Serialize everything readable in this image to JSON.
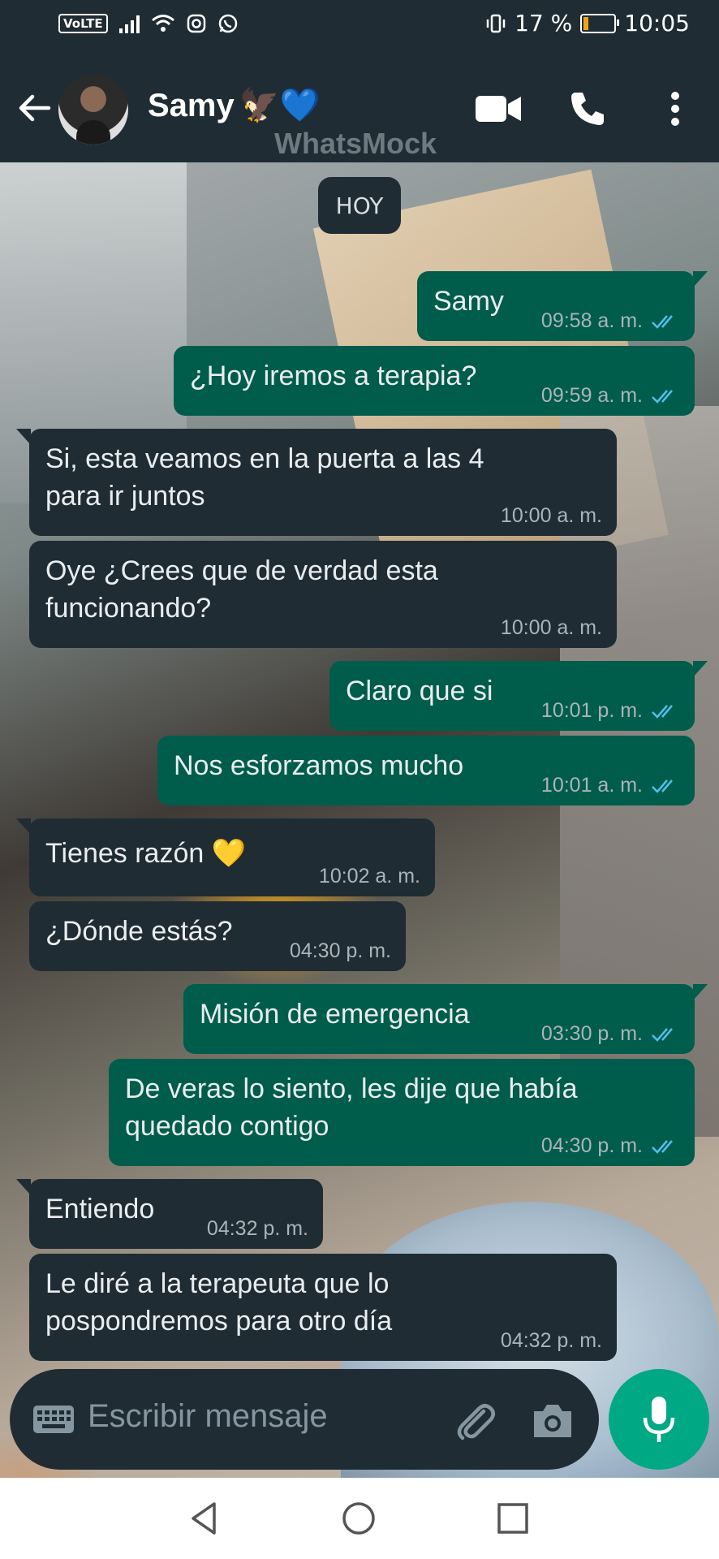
{
  "status_bar": {
    "volte": "VoLTE",
    "battery_text": "17 %",
    "battery_level": 0.17,
    "time": "10:05",
    "icons": [
      "signal-icon",
      "wifi-icon",
      "instagram-icon",
      "whatsapp-icon",
      "vibrate-icon",
      "battery-icon"
    ]
  },
  "header": {
    "contact_name": "Samy",
    "contact_emoji": "🦅💙",
    "watermark": "WhatsMock",
    "icons": [
      "back-arrow-icon",
      "video-call-icon",
      "phone-icon",
      "more-options-icon"
    ]
  },
  "chat": {
    "date_chip": "HOY",
    "messages": [
      {
        "dir": "out",
        "text": "Samy",
        "time": "09:58 a. m.",
        "ticks": "read"
      },
      {
        "dir": "out",
        "text": "¿Hoy iremos a terapia?",
        "time": "09:59 a. m.",
        "ticks": "read"
      },
      {
        "dir": "in",
        "text": "Si, esta veamos en la puerta a las 4",
        "text2": "para ir juntos",
        "time": "10:00 a. m."
      },
      {
        "dir": "in",
        "text": "Oye ¿Crees que de verdad esta",
        "text2": "funcionando?",
        "time": "10:00 a. m."
      },
      {
        "dir": "out",
        "text": "Claro que si",
        "time": "10:01 p. m.",
        "ticks": "read"
      },
      {
        "dir": "out",
        "text": "Nos esforzamos mucho",
        "time": "10:01 a. m.",
        "ticks": "read"
      },
      {
        "dir": "in",
        "text": "Tienes razón 💛",
        "time": "10:02 a. m."
      },
      {
        "dir": "in",
        "text": "¿Dónde estás?",
        "time": "04:30 p. m."
      },
      {
        "dir": "out",
        "text": "Misión de emergencia",
        "time": "03:30 p. m.",
        "ticks": "read"
      },
      {
        "dir": "out",
        "text": "De veras lo siento, les dije que había",
        "text2": "quedado contigo",
        "time": "04:30 p. m.",
        "ticks": "read"
      },
      {
        "dir": "in",
        "text": "Entiendo",
        "time": "04:32 p. m."
      },
      {
        "dir": "in",
        "text": "Le diré a la terapeuta que lo",
        "text2": "pospondremos para otro día",
        "time": "04:32 p. m."
      }
    ]
  },
  "composer": {
    "placeholder": "Escribir mensaje",
    "icons": [
      "keyboard-icon",
      "attach-icon",
      "camera-icon",
      "microphone-icon"
    ]
  },
  "nav_bar": {
    "icons": [
      "nav-back-icon",
      "nav-home-icon",
      "nav-recents-icon"
    ]
  },
  "colors": {
    "header_bg": "#1f2c33",
    "incoming_bubble": "#1f2c33",
    "outgoing_bubble": "#005c4b",
    "read_tick": "#53bdeb",
    "mic_button": "#00a884"
  }
}
